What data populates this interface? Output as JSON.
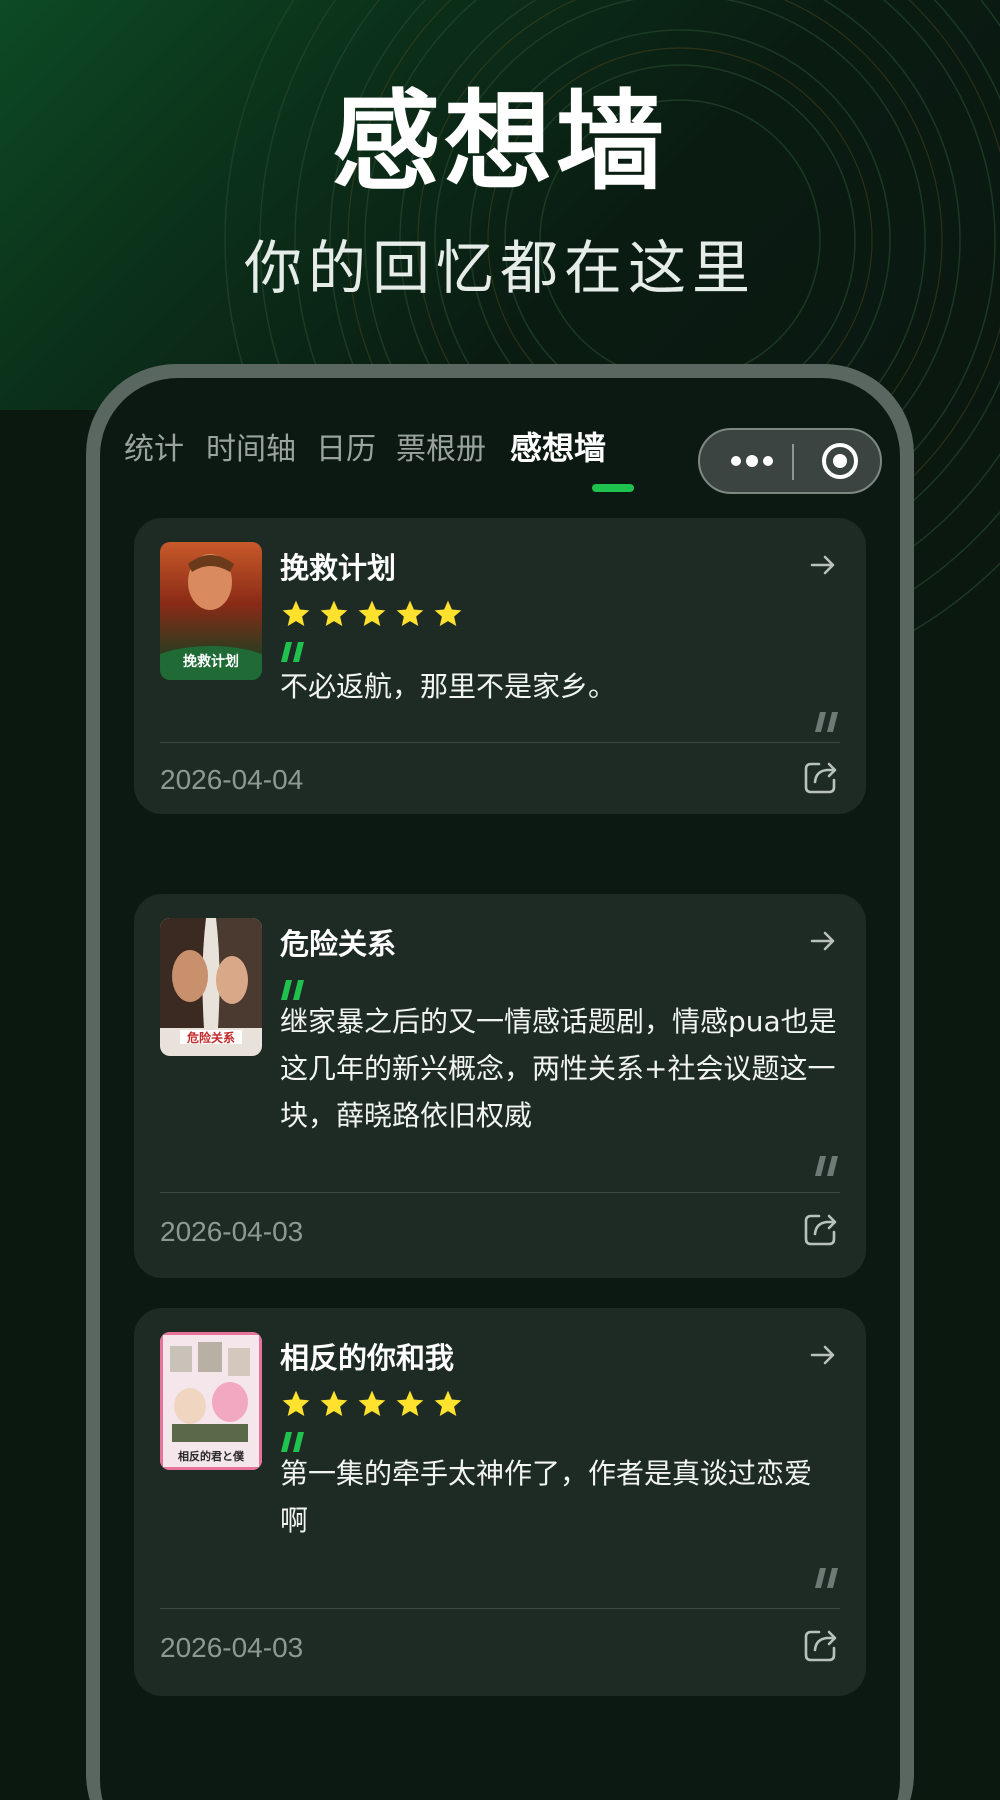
{
  "hero": {
    "title": "感想墙",
    "subtitle": "你的回忆都在这里"
  },
  "tabs": [
    {
      "label": "统计",
      "active": false
    },
    {
      "label": "时间轴",
      "active": false
    },
    {
      "label": "日历",
      "active": false
    },
    {
      "label": "票根册",
      "active": false
    },
    {
      "label": "感想墙",
      "active": true
    }
  ],
  "colors": {
    "accent": "#1fc24d",
    "star": "#ffe12e",
    "card": "#1e2b25"
  },
  "cards": [
    {
      "title": "挽救计划",
      "rating": 5,
      "text": "不必返航，那里不是家乡。",
      "date": "2026-04-04",
      "poster_icon": "movie-poster-image",
      "poster_text": "挽救计划"
    },
    {
      "title": "危险关系",
      "rating": 0,
      "text": "继家暴之后的又一情感话题剧，情感pua也是这几年的新兴概念，两性关系+社会议题这一块，薛晓路依旧权威",
      "date": "2026-04-03",
      "poster_icon": "movie-poster-image",
      "poster_text": "危险关系"
    },
    {
      "title": "相反的你和我",
      "rating": 5,
      "text": "第一集的牵手太神作了，作者是真谈过恋爱啊",
      "date": "2026-04-03",
      "poster_icon": "movie-poster-image",
      "poster_text": "相反的君と僕"
    }
  ]
}
